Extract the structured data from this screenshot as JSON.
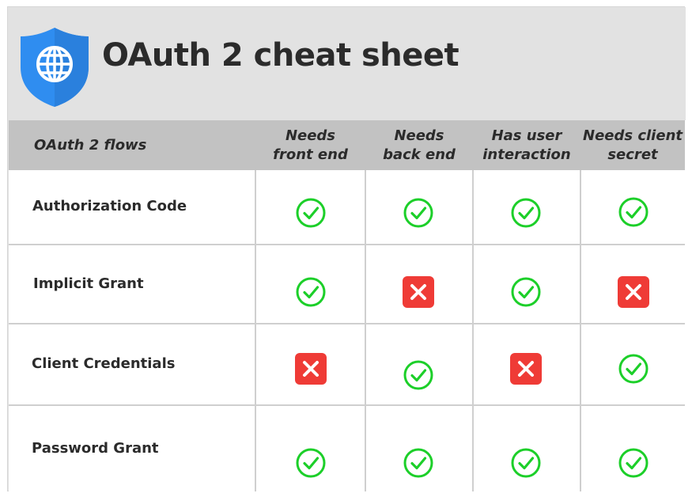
{
  "title": "OAuth 2 cheat sheet",
  "logo_icon": "shield-globe-icon",
  "colors": {
    "yes": "#1ccf29",
    "no": "#ef3b36",
    "shield": "#2f8df0"
  },
  "columns": [
    "OAuth 2 flows",
    "Needs\nfront end",
    "Needs\nback end",
    "Has user\ninteraction",
    "Needs client\nsecret"
  ],
  "rows": [
    {
      "label": "Authorization Code",
      "values": [
        "yes",
        "yes",
        "yes",
        "yes"
      ]
    },
    {
      "label": "Implicit Grant",
      "values": [
        "yes",
        "no",
        "yes",
        "no"
      ]
    },
    {
      "label": "Client Credentials",
      "values": [
        "no",
        "yes",
        "no",
        "yes"
      ]
    },
    {
      "label": "Password Grant",
      "values": [
        "yes",
        "yes",
        "yes",
        "yes"
      ]
    }
  ]
}
